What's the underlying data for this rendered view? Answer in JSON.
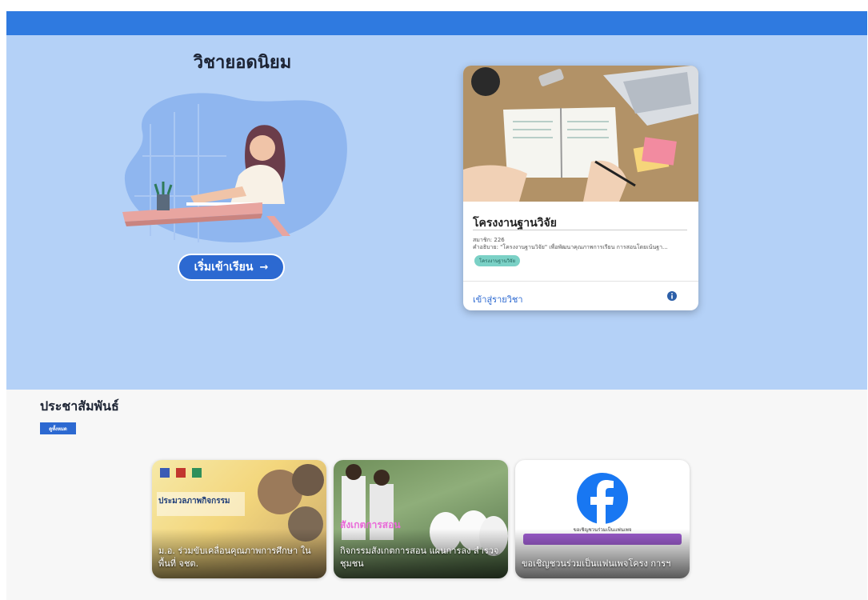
{
  "hero": {
    "title": "วิชายอดนิยม",
    "start_button_label": "เริ่มเข้าเรียน",
    "start_button_arrow": "→"
  },
  "course_card": {
    "title": "โครงงานฐานวิจัย",
    "members": "สมาชิก: 226",
    "description": "คำอธิบาย: \"โครงงานฐานวิจัย\" เพื่อพัฒนาคุณภาพการเรียน การสอนโดยเน้นฐา...",
    "tag": "โครงงานฐานวิจัย",
    "link_label": "เข้าสู่รายวิชา"
  },
  "pr": {
    "title": "ประชาสัมพันธ์",
    "see_all_label": "ดูทั้งหมด",
    "items": [
      {
        "caption": "ม.อ. ร่วมขับเคลื่อนคุณภาพการศึกษา ในพื้นที่ จชต.",
        "image_text": "ประมวลภาพกิจกรรม"
      },
      {
        "caption": "กิจกรรมสังเกตการสอน แผนการลง สำรวจชุมชน",
        "image_text": "สังเกตการสอน"
      },
      {
        "caption": "ขอเชิญชวนร่วมเป็นแฟนเพจโครง การฯ",
        "image_text": "ขอเชิญชวนร่วมเป็นแฟนเพจ"
      }
    ]
  },
  "colors": {
    "topbar": "#2f7ae0",
    "hero_bg": "#b4d1f7",
    "accent": "#2c69d1",
    "tag_bg": "#7bd1c6"
  }
}
